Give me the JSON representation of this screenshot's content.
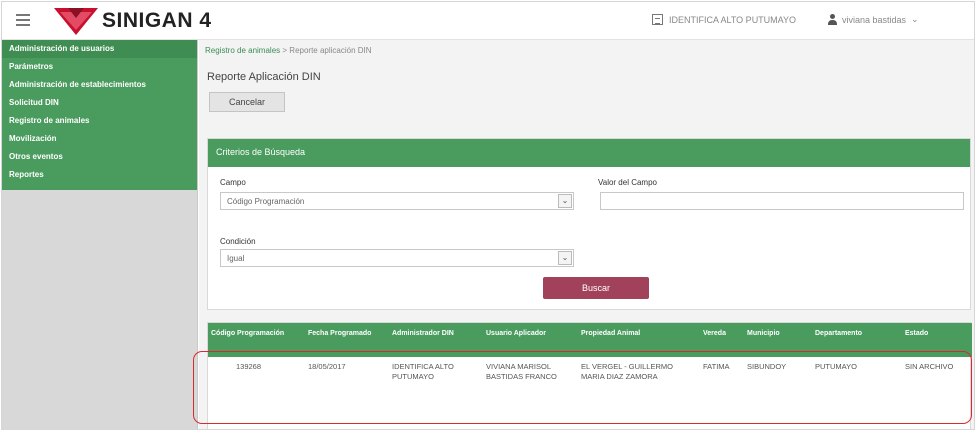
{
  "app": {
    "brand": "SINIGAN 4",
    "establishment": "IDENTIFICA ALTO PUTUMAYO",
    "user": "viviana bastidas"
  },
  "sidebar": {
    "items": [
      {
        "label": "Administración de usuarios"
      },
      {
        "label": "Parámetros"
      },
      {
        "label": "Administración de establecimientos"
      },
      {
        "label": "Solicitud DIN"
      },
      {
        "label": "Registro de animales"
      },
      {
        "label": "Movilización"
      },
      {
        "label": "Otros eventos"
      },
      {
        "label": "Reportes"
      }
    ]
  },
  "breadcrumb": {
    "parent": "Registro de animales",
    "separator": ">",
    "current": "Reporte aplicación DIN"
  },
  "page": {
    "title": "Reporte Aplicación DIN",
    "cancel_label": "Cancelar"
  },
  "search": {
    "panel_title": "Criterios de Búsqueda",
    "campo_label": "Campo",
    "campo_value": "Código Programación",
    "valor_label": "Valor del Campo",
    "valor_value": "",
    "condicion_label": "Condición",
    "condicion_value": "Igual",
    "search_label": "Buscar"
  },
  "table": {
    "headers": [
      "Código Programación",
      "Fecha Programado",
      "Administrador DIN",
      "Usuario Aplicador",
      "Propiedad Animal",
      "Vereda",
      "Municipio",
      "Departamento",
      "Estado"
    ],
    "rows": [
      {
        "cells": [
          "139268",
          "18/05/2017",
          "IDENTIFICA ALTO PUTUMAYO",
          "VIVIANA MARISOL BASTIDAS FRANCO",
          "EL VERGEL - GUILLERMO MARIA DIAZ ZAMORA",
          "FATIMA",
          "SIBUNDOY",
          "PUTUMAYO",
          "SIN ARCHIVO"
        ]
      }
    ]
  },
  "colors": {
    "accent_green": "#4a9b5e",
    "search_button": "#a1425a",
    "highlight": "#d9282e"
  },
  "icons": {
    "menu": "hamburger-icon",
    "logo": "sinigan-logo",
    "establishment": "building-icon",
    "user": "user-icon",
    "dropdown": "chevron-down-icon"
  }
}
